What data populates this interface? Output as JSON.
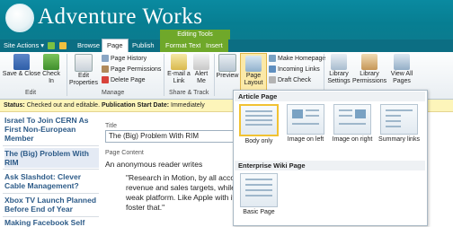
{
  "site": {
    "title": "Adventure Works"
  },
  "ribbon_context": {
    "editing_tools": "Editing Tools"
  },
  "tabs": {
    "site_actions": "Site Actions",
    "browse": "Browse",
    "page": "Page",
    "publish": "Publish",
    "format_text": "Format Text",
    "insert": "Insert"
  },
  "ribbon": {
    "save_close": "Save & Close",
    "check_in": "Check In",
    "edit_group": "Edit",
    "edit_properties": "Edit Properties",
    "page_history": "Page History",
    "page_permissions": "Page Permissions",
    "delete_page": "Delete Page",
    "manage_group": "Manage",
    "email_link": "E-mail a Link",
    "alert_me": "Alert Me",
    "share_track_group": "Share & Track",
    "preview": "Preview",
    "page_layout": "Page Layout",
    "make_homepage": "Make Homepage",
    "incoming_links": "Incoming Links",
    "draft_check": "Draft Check",
    "library_settings": "Library Settings",
    "library_permissions": "Library Permissions",
    "view_all_pages": "View All Pages"
  },
  "status": {
    "label": "Status:",
    "text": "Checked out and editable.",
    "pub_label": "Publication Start Date:",
    "pub_value": "Immediately"
  },
  "nav": [
    "Israel To Join CERN As First Non-European Member",
    "The (Big) Problem With RIM",
    "Ask Slashdot: Clever Cable Management?",
    "Xbox TV Launch Planned Before End of Year",
    "Making Facebook Self"
  ],
  "content": {
    "title_label": "Title",
    "title_value": "The (Big) Problem With RIM",
    "page_content_label": "Page Content",
    "byline": "An anonymous reader writes",
    "quote_lines": [
      "\"Research in Motion, by all accounts,",
      "revenue and sales targets, while marg",
      "weak platform. Like Apple with its iOS",
      "foster that.\""
    ],
    "ghost": "ayBook"
  },
  "layout_menu": {
    "article_header": "Article Page",
    "article_options": [
      "Body only",
      "Image on left",
      "Image on right",
      "Summary links"
    ],
    "wiki_header": "Enterprise Wiki Page",
    "wiki_options": [
      "Basic Page"
    ]
  }
}
